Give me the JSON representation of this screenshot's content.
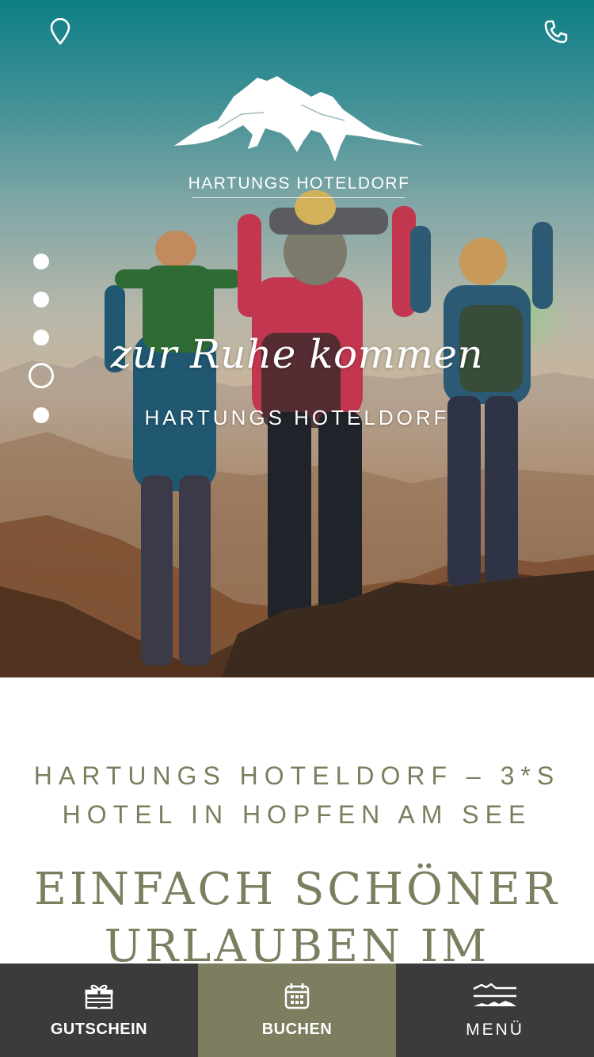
{
  "header": {
    "location_icon": "map-pin-icon",
    "phone_icon": "phone-icon"
  },
  "logo": {
    "name": "HARTUNGS HOTELDORF"
  },
  "hero": {
    "script_title": "zur Ruhe kommen",
    "subtitle": "HARTUNGS HOTELDORF",
    "slides": 5,
    "active_slide": 4
  },
  "content": {
    "kicker_line1": "HARTUNGS HOTELDORF – 3*S",
    "kicker_line2": "HOTEL IN HOPFEN AM SEE",
    "headline_line1": "EINFACH SCHÖNER",
    "headline_line2": "URLAUBEN IM"
  },
  "bottom_nav": {
    "voucher_label": "GUTSCHEIN",
    "voucher_icon": "gift-icon",
    "book_label": "BUCHEN",
    "book_icon": "calendar-icon",
    "menu_label": "MENÜ",
    "menu_icon": "mountain-menu-icon"
  },
  "colors": {
    "accent": "#7d7e5f",
    "dark": "#3b3b3b",
    "white": "#ffffff"
  }
}
